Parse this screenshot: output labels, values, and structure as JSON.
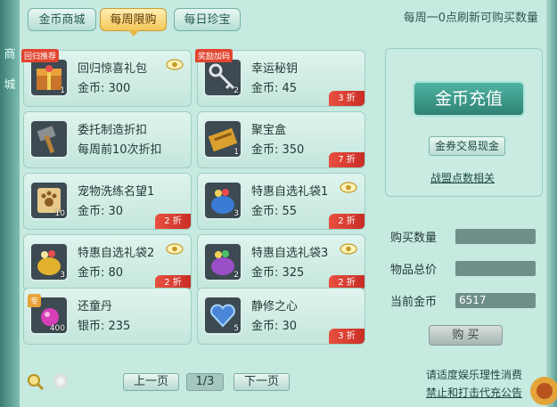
{
  "tabs": [
    {
      "label": "金币商城",
      "active": false
    },
    {
      "label": "每周限购",
      "active": true
    },
    {
      "label": "每日珍宝",
      "active": false
    }
  ],
  "refresh_text": "每周一0点刷新可购买数量",
  "left_deco": [
    "商",
    "城"
  ],
  "items": [
    {
      "name": "回归惊喜礼包",
      "price": "金币: 300",
      "qty": "1",
      "badge": "回归推荐",
      "eye": true,
      "discount": "",
      "icon": "gift-chest-icon"
    },
    {
      "name": "幸运秘钥",
      "price": "金币: 45",
      "qty": "2",
      "badge": "奖励加码",
      "eye": false,
      "discount": "3 折",
      "icon": "key-icon"
    },
    {
      "name": "委托制造折扣",
      "price": "每周前10次折扣",
      "qty": "",
      "badge": "",
      "eye": false,
      "discount": "",
      "icon": "hammer-icon"
    },
    {
      "name": "聚宝盒",
      "price": "金币: 350",
      "qty": "1",
      "badge": "",
      "eye": false,
      "discount": "7 折",
      "icon": "treasure-box-icon"
    },
    {
      "name": "宠物洗练名望1",
      "price": "金币: 30",
      "qty": "10",
      "badge": "",
      "eye": false,
      "discount": "2 折",
      "icon": "paw-scroll-icon"
    },
    {
      "name": "特惠自选礼袋1",
      "price": "金币: 55",
      "qty": "3",
      "badge": "",
      "eye": true,
      "discount": "2 折",
      "icon": "blue-bag-icon"
    },
    {
      "name": "特惠自选礼袋2",
      "price": "金币: 80",
      "qty": "3",
      "badge": "",
      "eye": true,
      "discount": "2 折",
      "icon": "gold-bag-icon"
    },
    {
      "name": "特惠自选礼袋3",
      "price": "金币: 325",
      "qty": "2",
      "badge": "",
      "eye": true,
      "discount": "2 折",
      "icon": "purple-bag-icon"
    },
    {
      "name": "还童丹",
      "price": "银币: 235",
      "qty": "400",
      "badge": "专",
      "eye": false,
      "discount": "",
      "icon": "pink-pill-icon"
    },
    {
      "name": "静修之心",
      "price": "金币: 30",
      "qty": "5",
      "badge": "",
      "eye": false,
      "discount": "3 折",
      "icon": "heart-crystal-icon"
    }
  ],
  "side": {
    "recharge": "金币充值",
    "voucher": "金券交易现金",
    "alliance": "战盟点数相关"
  },
  "form": {
    "buy_qty_label": "购买数量",
    "buy_qty_value": "",
    "total_label": "物品总价",
    "total_value": "",
    "gold_label": "当前金币",
    "gold_value": "6517",
    "buy_button": "购 买"
  },
  "pager": {
    "prev": "上一页",
    "page": "1/3",
    "next": "下一页"
  },
  "notice": {
    "line1": "请适度娱乐理性消费",
    "line2": "禁止和打击代充公告"
  },
  "colors": {
    "panel": "#c6e9e0",
    "active_tab": "#f4c758",
    "discount": "#e1452f",
    "recharge": "#3a9887"
  }
}
